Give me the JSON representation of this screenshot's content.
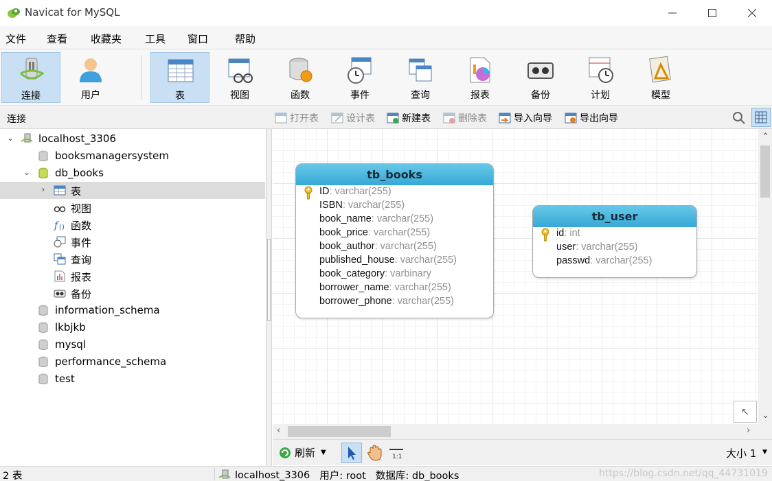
{
  "window": {
    "title": "Navicat for MySQL"
  },
  "menu": [
    "文件",
    "查看",
    "收藏夹",
    "工具",
    "窗口",
    "帮助"
  ],
  "toolbar": {
    "connect": "连接",
    "user": "用户",
    "table": "表",
    "view": "视图",
    "function": "函数",
    "event": "事件",
    "query": "查询",
    "report": "报表",
    "backup": "备份",
    "schedule": "计划",
    "model": "模型"
  },
  "panel": {
    "title": "连接"
  },
  "subtoolbar": {
    "open_table": "打开表",
    "design_table": "设计表",
    "new_table": "新建表",
    "delete_table": "删除表",
    "import_wizard": "导入向导",
    "export_wizard": "导出向导"
  },
  "tree": {
    "connection": "localhost_3306",
    "databases": [
      "booksmanagersystem",
      "db_books",
      "information_schema",
      "lkbjkb",
      "mysql",
      "performance_schema",
      "test"
    ],
    "objects": {
      "table": "表",
      "view": "视图",
      "function": "函数",
      "event": "事件",
      "query": "查询",
      "report": "报表",
      "backup": "备份"
    }
  },
  "er_tables": [
    {
      "name": "tb_books",
      "fields": [
        {
          "name": "ID",
          "type": ": varchar(255)",
          "key": true
        },
        {
          "name": "ISBN",
          "type": ": varchar(255)"
        },
        {
          "name": "book_name",
          "type": ": varchar(255)"
        },
        {
          "name": "book_price",
          "type": ": varchar(255)"
        },
        {
          "name": "book_author",
          "type": ": varchar(255)"
        },
        {
          "name": "published_house",
          "type": ": varchar(255)"
        },
        {
          "name": "book_category",
          "type": ": varbinary"
        },
        {
          "name": "borrower_name",
          "type": ": varchar(255)"
        },
        {
          "name": "borrower_phone",
          "type": ": varchar(255)"
        }
      ]
    },
    {
      "name": "tb_user",
      "fields": [
        {
          "name": "id",
          "type": ": int",
          "key": true
        },
        {
          "name": "user",
          "type": ": varchar(255)"
        },
        {
          "name": "passwd",
          "type": ": varchar(255)"
        }
      ]
    }
  ],
  "canvasbar": {
    "refresh": "刷新",
    "zoom": "大小 1"
  },
  "status": {
    "count": "2 表",
    "connection": "localhost_3306",
    "user": "用户: root",
    "database": "数据库: db_books",
    "watermark": "https://blog.csdn.net/qq_44731019"
  },
  "colors": {
    "accent": "#c9dff3",
    "er_header": "#3fb1da"
  }
}
